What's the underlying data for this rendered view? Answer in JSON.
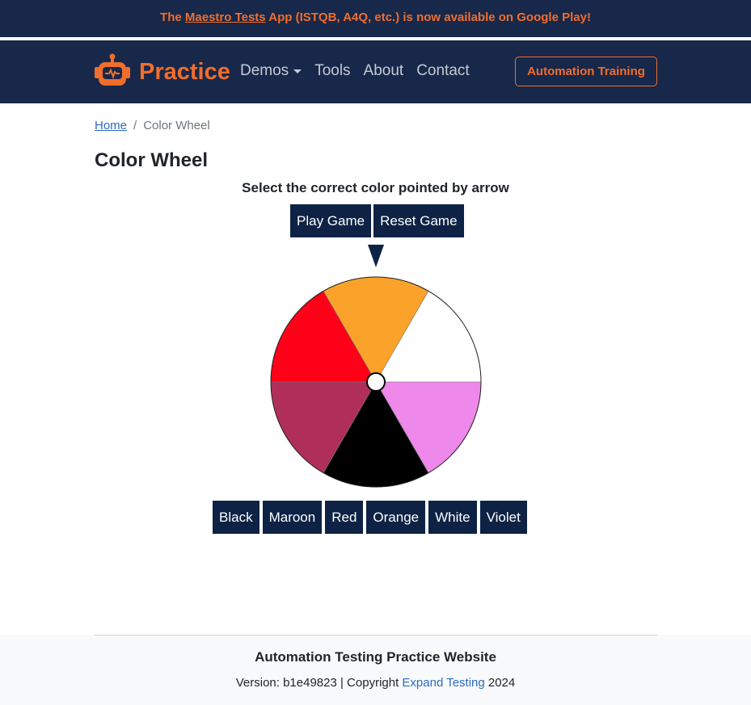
{
  "announcement": {
    "prefix": "The ",
    "link": "Maestro Tests",
    "suffix": " App (ISTQB, A4Q, etc.) is now available on Google Play!"
  },
  "navbar": {
    "brand": "Practice",
    "links": [
      {
        "label": "Demos",
        "dropdown": true
      },
      {
        "label": "Tools"
      },
      {
        "label": "About"
      },
      {
        "label": "Contact"
      }
    ],
    "cta": "Automation Training"
  },
  "breadcrumb": {
    "home": "Home",
    "separator": "/",
    "current": "Color Wheel"
  },
  "page": {
    "title": "Color Wheel",
    "instruction": "Select the correct color pointed by arrow"
  },
  "game_buttons": {
    "play": "Play Game",
    "reset": "Reset Game"
  },
  "wheel": {
    "segments": [
      {
        "name": "Orange",
        "color": "#fba22a"
      },
      {
        "name": "White",
        "color": "#ffffff"
      },
      {
        "name": "Violet",
        "color": "#ee88ea"
      },
      {
        "name": "Black",
        "color": "#000000"
      },
      {
        "name": "Maroon",
        "color": "#b02e5a"
      },
      {
        "name": "Red",
        "color": "#ff0019"
      }
    ],
    "pointer_icon": "arrow-down-icon"
  },
  "answers": [
    "Black",
    "Maroon",
    "Red",
    "Orange",
    "White",
    "Violet"
  ],
  "footer": {
    "title": "Automation Testing Practice Website",
    "version_prefix": "Version: b1e49823 | Copyright ",
    "company": "Expand Testing",
    "year": " 2024"
  },
  "colors": {
    "nav_bg": "#17284a",
    "accent": "#f16d2c",
    "button_bg": "#0d2244",
    "link": "#2b6cc4"
  }
}
